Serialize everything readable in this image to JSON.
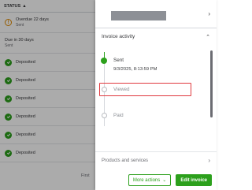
{
  "invoices_list": {
    "status_header": "STATUS",
    "sort_arrow": "▲",
    "rows": [
      {
        "status": "Overdue 22 days",
        "sub": "Sent",
        "icon": "warning-icon"
      },
      {
        "status": "Due in 30 days",
        "sub": "Sent",
        "icon": "none"
      },
      {
        "status": "Deposited",
        "icon": "check-circle-icon"
      },
      {
        "status": "Deposited",
        "icon": "check-circle-icon"
      },
      {
        "status": "Deposited",
        "icon": "check-circle-icon"
      },
      {
        "status": "Deposited",
        "icon": "check-circle-icon"
      },
      {
        "status": "Deposited",
        "icon": "check-circle-icon"
      },
      {
        "status": "Deposited",
        "icon": "check-circle-icon"
      }
    ],
    "pagination_first": "First"
  },
  "drawer": {
    "invoice_activity": {
      "title": "Invoice activity",
      "steps": [
        {
          "label": "Sent",
          "date": "9/3/2025, 8:13:59 PM",
          "state": "completed"
        },
        {
          "label": "Viewed",
          "state": "pending"
        },
        {
          "label": "Paid",
          "state": "pending"
        }
      ]
    },
    "products_section": {
      "title": "Products and services"
    },
    "footer": {
      "more_actions": "More actions",
      "edit_invoice": "Edit invoice"
    }
  },
  "colors": {
    "accent": "#2ca01c",
    "warning": "#e08a00",
    "highlight": "#e0393e"
  }
}
